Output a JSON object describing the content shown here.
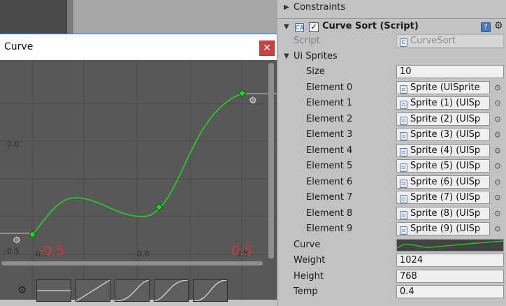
{
  "curve_window": {
    "title": "Curve",
    "close_icon": "close-icon",
    "axis_labels": [
      "0.0",
      "-0.5",
      "-0.5",
      "0.0",
      "0.5"
    ],
    "range_labels": [
      "-0.5",
      "0.5"
    ],
    "gear_icon": "gear-icon",
    "presets_count": 5
  },
  "inspector": {
    "constraints_label": "Constraints",
    "component_title": "Curve Sort (Script)",
    "component_enabled": true,
    "help_icon": "help-icon",
    "settings_icon": "gear-icon",
    "script": {
      "label": "Script",
      "value": "CurveSort"
    },
    "ui_sprites": {
      "label": "Ui Sprites",
      "size_label": "Size",
      "size_value": "10",
      "elements": [
        {
          "label": "Element 0",
          "value": "Sprite (UISprite"
        },
        {
          "label": "Element 1",
          "value": "Sprite (1) (UISp"
        },
        {
          "label": "Element 2",
          "value": "Sprite (2) (UISp"
        },
        {
          "label": "Element 3",
          "value": "Sprite (3) (UISp"
        },
        {
          "label": "Element 4",
          "value": "Sprite (4) (UISp"
        },
        {
          "label": "Element 5",
          "value": "Sprite (5) (UISp"
        },
        {
          "label": "Element 6",
          "value": "Sprite (6) (UISp"
        },
        {
          "label": "Element 7",
          "value": "Sprite (7) (UISp"
        },
        {
          "label": "Element 8",
          "value": "Sprite (8) (UISp"
        },
        {
          "label": "Element 9",
          "value": "Sprite (9) (UISp"
        }
      ]
    },
    "curve_label": "Curve",
    "weight": {
      "label": "Weight",
      "value": "1024"
    },
    "height": {
      "label": "Height",
      "value": "768"
    },
    "temp": {
      "label": "Temp",
      "value": "0.4"
    }
  },
  "colors": {
    "curve": "#22d422",
    "range_text": "#d23a3a",
    "graph_bg": "#585858",
    "panel_bg": "#c2c2c2"
  }
}
